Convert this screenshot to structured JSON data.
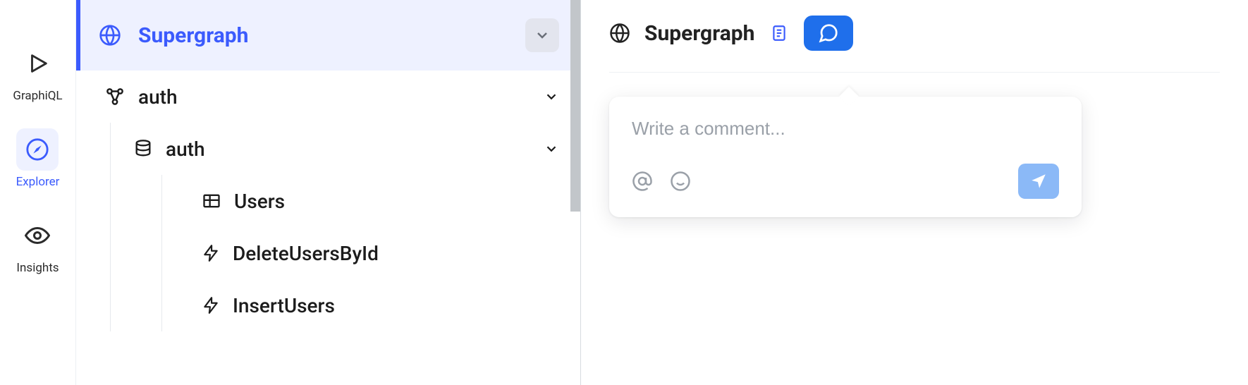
{
  "vnav": {
    "items": [
      {
        "label": "GraphiQL"
      },
      {
        "label": "Explorer"
      },
      {
        "label": "Insights"
      }
    ]
  },
  "explorer": {
    "supergraph_label": "Supergraph",
    "tree": {
      "subgraph": {
        "label": "auth"
      },
      "source": {
        "label": "auth"
      },
      "items": [
        {
          "label": "Users"
        },
        {
          "label": "DeleteUsersById"
        },
        {
          "label": "InsertUsers"
        }
      ]
    }
  },
  "right": {
    "title": "Supergraph",
    "comment_placeholder": "Write a comment..."
  }
}
